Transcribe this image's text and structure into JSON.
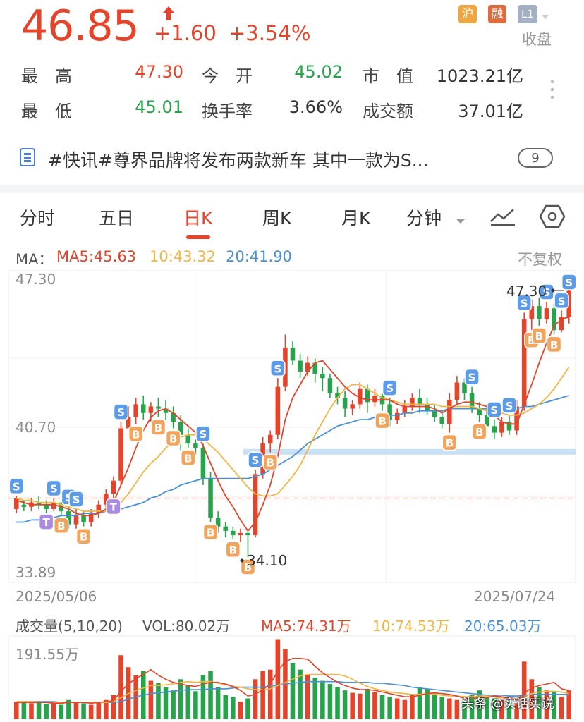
{
  "quote": {
    "price": "46.85",
    "change": "+1.60",
    "change_pct": "+3.54%",
    "badges": [
      "沪",
      "融",
      "L1"
    ],
    "market_status": "收盘",
    "stats": [
      {
        "label": "最　高",
        "value": "47.30",
        "color": "#e5432a"
      },
      {
        "label": "今　开",
        "value": "45.02",
        "color": "#27a44b"
      },
      {
        "label": "市　值",
        "value": "1023.21亿",
        "color": "#333333"
      },
      {
        "label": "最　低",
        "value": "45.01",
        "color": "#27a44b"
      },
      {
        "label": "换手率",
        "value": "3.66%",
        "color": "#333333"
      },
      {
        "label": "成交额",
        "value": "37.01亿",
        "color": "#333333"
      }
    ]
  },
  "news": {
    "text": "#快讯#尊界品牌将发布两款新车 其中一款为S...",
    "count": "9"
  },
  "tabs": [
    {
      "label": "分时",
      "active": false
    },
    {
      "label": "五日",
      "active": false
    },
    {
      "label": "日K",
      "active": true
    },
    {
      "label": "周K",
      "active": false
    },
    {
      "label": "月K",
      "active": false
    },
    {
      "label": "分钟",
      "active": false
    }
  ],
  "ma_legend": {
    "title": "MA：",
    "ma5": "MA5:45.63",
    "ma10": "10:43.32",
    "ma20": "20:41.90",
    "adjust": "不复权"
  },
  "colors": {
    "up": "#e5432a",
    "down": "#27a44b",
    "ma5": "#e5432a",
    "ma10": "#f0b542",
    "ma20": "#4a90d8",
    "buy": "#f2a35c",
    "sell": "#5b9be8",
    "t": "#a98be0"
  },
  "chart_data": {
    "type": "candlestick",
    "price_labels": [
      "47.30",
      "40.70",
      "33.89"
    ],
    "ylim": [
      33.89,
      47.3
    ],
    "date_start": "2025/05/06",
    "date_end": "2025/07/24",
    "high_label": "47.30",
    "low_label": "34.10",
    "candles": [
      [
        36.8,
        37.3,
        37.4,
        36.6
      ],
      [
        37.0,
        36.9,
        37.2,
        36.7
      ],
      [
        36.9,
        37.1,
        37.3,
        36.7
      ],
      [
        37.1,
        37.0,
        37.4,
        36.8
      ],
      [
        37.0,
        36.8,
        37.2,
        36.6
      ],
      [
        36.8,
        37.1,
        37.3,
        36.7
      ],
      [
        37.1,
        36.7,
        37.3,
        36.5
      ],
      [
        36.7,
        36.1,
        36.9,
        35.9
      ],
      [
        36.1,
        36.5,
        36.8,
        35.9
      ],
      [
        36.5,
        36.2,
        36.7,
        36.0
      ],
      [
        36.2,
        36.6,
        36.8,
        36.0
      ],
      [
        36.6,
        37.0,
        37.2,
        36.4
      ],
      [
        37.0,
        37.5,
        37.7,
        36.8
      ],
      [
        37.5,
        38.1,
        38.3,
        37.3
      ],
      [
        38.1,
        40.5,
        40.8,
        37.9
      ],
      [
        40.5,
        41.0,
        41.5,
        40.2
      ],
      [
        41.0,
        41.6,
        41.9,
        40.7
      ],
      [
        41.6,
        41.2,
        42.0,
        40.9
      ],
      [
        41.2,
        41.5,
        41.7,
        40.8
      ],
      [
        41.5,
        41.4,
        41.9,
        41.0
      ],
      [
        41.4,
        41.2,
        41.8,
        40.9
      ],
      [
        41.2,
        40.8,
        41.5,
        40.5
      ],
      [
        40.8,
        40.2,
        41.1,
        39.5
      ],
      [
        40.2,
        39.8,
        40.5,
        39.6
      ],
      [
        39.8,
        39.6,
        40.0,
        39.3
      ],
      [
        39.6,
        38.2,
        39.8,
        37.9
      ],
      [
        38.2,
        36.4,
        38.5,
        36.2
      ],
      [
        36.4,
        36.0,
        36.7,
        35.7
      ],
      [
        36.0,
        35.8,
        36.2,
        35.5
      ],
      [
        35.8,
        35.6,
        36.0,
        35.4
      ],
      [
        35.6,
        35.7,
        35.9,
        35.3
      ],
      [
        35.7,
        35.6,
        35.9,
        34.6
      ],
      [
        35.6,
        38.4,
        38.6,
        35.5
      ],
      [
        38.4,
        39.8,
        40.1,
        38.2
      ],
      [
        39.8,
        40.2,
        40.4,
        39.4
      ],
      [
        40.2,
        42.4,
        42.8,
        40.0
      ],
      [
        42.4,
        44.2,
        44.8,
        42.2
      ],
      [
        44.2,
        43.6,
        44.5,
        43.4
      ],
      [
        43.6,
        43.1,
        43.9,
        42.8
      ],
      [
        43.1,
        43.5,
        43.8,
        42.9
      ],
      [
        43.5,
        43.0,
        43.7,
        42.6
      ],
      [
        43.0,
        42.8,
        43.3,
        42.2
      ],
      [
        42.8,
        42.1,
        43.0,
        41.9
      ],
      [
        42.1,
        41.9,
        42.4,
        41.6
      ],
      [
        41.9,
        41.4,
        42.2,
        41.0
      ],
      [
        41.4,
        41.6,
        41.8,
        41.1
      ],
      [
        41.6,
        42.3,
        42.6,
        41.4
      ],
      [
        42.3,
        41.7,
        42.5,
        41.2
      ],
      [
        41.7,
        42.0,
        42.3,
        41.5
      ],
      [
        42.0,
        41.6,
        42.2,
        41.3
      ],
      [
        41.6,
        40.9,
        41.9,
        40.6
      ],
      [
        40.9,
        41.2,
        41.4,
        40.7
      ],
      [
        41.2,
        41.5,
        41.8,
        41.0
      ],
      [
        41.5,
        41.9,
        42.1,
        41.3
      ],
      [
        41.9,
        41.6,
        42.3,
        41.2
      ],
      [
        41.6,
        41.3,
        41.9,
        41.1
      ],
      [
        41.3,
        41.0,
        41.6,
        40.8
      ],
      [
        41.0,
        40.7,
        41.3,
        40.5
      ],
      [
        40.7,
        41.8,
        42.1,
        40.3
      ],
      [
        41.8,
        42.6,
        42.9,
        41.6
      ],
      [
        42.6,
        42.1,
        42.8,
        41.8
      ],
      [
        42.1,
        41.4,
        42.4,
        41.2
      ],
      [
        41.4,
        41.1,
        41.7,
        40.8
      ],
      [
        41.1,
        40.6,
        41.4,
        40.3
      ],
      [
        40.6,
        40.3,
        40.9,
        40.0
      ],
      [
        40.3,
        40.8,
        41.0,
        40.1
      ],
      [
        40.8,
        40.4,
        41.1,
        40.2
      ],
      [
        40.4,
        41.5,
        41.8,
        40.2
      ],
      [
        41.5,
        45.5,
        45.8,
        41.3
      ],
      [
        45.5,
        46.1,
        46.4,
        45.0
      ],
      [
        46.1,
        45.5,
        46.5,
        45.2
      ],
      [
        45.5,
        46.0,
        46.3,
        45.3
      ],
      [
        46.0,
        45.0,
        46.2,
        44.8
      ],
      [
        45.0,
        45.6,
        45.9,
        44.9
      ],
      [
        45.6,
        46.8,
        47.3,
        45.3
      ]
    ],
    "ma5": [
      37.2,
      37.1,
      37.0,
      37.0,
      37.0,
      37.0,
      36.9,
      36.8,
      36.6,
      36.5,
      36.5,
      36.6,
      36.8,
      37.1,
      37.9,
      38.7,
      39.6,
      40.4,
      41.0,
      41.3,
      41.4,
      41.2,
      40.9,
      40.6,
      40.3,
      39.7,
      38.9,
      38.1,
      37.4,
      36.9,
      36.3,
      35.8,
      36.2,
      37.0,
      37.9,
      39.2,
      40.9,
      41.9,
      42.5,
      43.1,
      43.5,
      43.6,
      43.2,
      42.8,
      42.4,
      42.1,
      41.9,
      41.8,
      41.8,
      41.8,
      41.8,
      41.6,
      41.5,
      41.5,
      41.5,
      41.5,
      41.4,
      41.2,
      41.4,
      41.6,
      41.7,
      41.7,
      41.6,
      41.5,
      41.1,
      40.8,
      40.7,
      40.7,
      41.6,
      42.5,
      43.5,
      44.4,
      45.2,
      45.5,
      45.6
    ],
    "ma10": [
      37.3,
      37.2,
      37.2,
      37.1,
      37.1,
      37.1,
      37.0,
      36.9,
      36.8,
      36.7,
      36.7,
      36.7,
      36.7,
      36.8,
      37.1,
      37.5,
      38.0,
      38.5,
      38.9,
      39.2,
      39.6,
      39.9,
      40.1,
      40.2,
      40.2,
      40.0,
      39.7,
      39.4,
      39.0,
      38.6,
      38.2,
      37.8,
      37.5,
      37.4,
      37.4,
      37.5,
      37.9,
      38.3,
      38.8,
      39.5,
      40.2,
      40.8,
      41.4,
      41.9,
      42.3,
      42.5,
      42.5,
      42.3,
      42.1,
      41.9,
      41.8,
      41.7,
      41.6,
      41.6,
      41.6,
      41.6,
      41.6,
      41.5,
      41.5,
      41.5,
      41.5,
      41.5,
      41.4,
      41.3,
      41.2,
      41.2,
      41.1,
      41.1,
      41.2,
      41.4,
      41.6,
      41.9,
      42.3,
      42.8,
      43.3
    ],
    "ma20": [
      36.2,
      36.2,
      36.3,
      36.3,
      36.4,
      36.4,
      36.5,
      36.5,
      36.5,
      36.6,
      36.6,
      36.6,
      36.7,
      36.7,
      36.8,
      36.9,
      37.0,
      37.1,
      37.3,
      37.4,
      37.6,
      37.7,
      37.9,
      38.0,
      38.1,
      38.2,
      38.2,
      38.2,
      38.2,
      38.2,
      38.2,
      38.2,
      38.3,
      38.4,
      38.6,
      38.8,
      39.0,
      39.2,
      39.5,
      39.8,
      40.0,
      40.2,
      40.4,
      40.6,
      40.7,
      40.8,
      40.9,
      40.9,
      41.0,
      41.0,
      41.1,
      41.1,
      41.2,
      41.2,
      41.3,
      41.3,
      41.3,
      41.3,
      41.4,
      41.4,
      41.4,
      41.4,
      41.4,
      41.4,
      41.4,
      41.4,
      41.4,
      41.4,
      41.5,
      41.5,
      41.6,
      41.7,
      41.8,
      41.9,
      42.0
    ],
    "markers": [
      {
        "i": 0,
        "t": "S"
      },
      {
        "i": 5,
        "t": "S"
      },
      {
        "i": 6,
        "t": "B"
      },
      {
        "i": 7,
        "t": "S"
      },
      {
        "i": 8,
        "t": "S"
      },
      {
        "i": 9,
        "t": "B"
      },
      {
        "i": 4,
        "t": "T"
      },
      {
        "i": 13,
        "t": "T"
      },
      {
        "i": 14,
        "t": "S"
      },
      {
        "i": 16,
        "t": "B"
      },
      {
        "i": 19,
        "t": "B"
      },
      {
        "i": 21,
        "t": "B"
      },
      {
        "i": 23,
        "t": "B"
      },
      {
        "i": 25,
        "t": "S"
      },
      {
        "i": 26,
        "t": "B"
      },
      {
        "i": 29,
        "t": "B"
      },
      {
        "i": 31,
        "t": "B"
      },
      {
        "i": 32,
        "t": "S"
      },
      {
        "i": 34,
        "t": "B"
      },
      {
        "i": 35,
        "t": "S"
      },
      {
        "i": 49,
        "t": "B"
      },
      {
        "i": 50,
        "t": "S"
      },
      {
        "i": 58,
        "t": "B"
      },
      {
        "i": 61,
        "t": "S"
      },
      {
        "i": 62,
        "t": "B"
      },
      {
        "i": 64,
        "t": "S"
      },
      {
        "i": 66,
        "t": "S"
      },
      {
        "i": 68,
        "t": "S"
      },
      {
        "i": 69,
        "t": "B"
      },
      {
        "i": 70,
        "t": "B"
      },
      {
        "i": 71,
        "t": "S"
      },
      {
        "i": 72,
        "t": "B"
      },
      {
        "i": 73,
        "t": "S"
      },
      {
        "i": 74,
        "t": "S"
      }
    ],
    "volume": [
      22,
      21,
      20,
      22,
      19,
      20,
      18,
      24,
      22,
      20,
      18,
      21,
      24,
      30,
      80,
      65,
      55,
      60,
      48,
      45,
      40,
      36,
      50,
      42,
      35,
      55,
      60,
      40,
      30,
      28,
      22,
      26,
      50,
      60,
      62,
      100,
      88,
      70,
      62,
      56,
      52,
      48,
      44,
      40,
      36,
      33,
      32,
      38,
      34,
      30,
      28,
      26,
      24,
      30,
      40,
      38,
      32,
      28,
      26,
      24,
      22,
      30,
      36,
      28,
      26,
      24,
      22,
      20,
      72,
      50,
      40,
      36,
      34,
      28,
      36
    ],
    "vol_ma5": [
      21,
      21,
      21,
      21,
      21,
      20,
      20,
      21,
      21,
      21,
      20,
      21,
      22,
      23,
      35,
      44,
      51,
      56,
      62,
      55,
      50,
      46,
      44,
      42,
      41,
      44,
      46,
      46,
      44,
      41,
      36,
      29,
      31,
      37,
      44,
      60,
      72,
      76,
      76,
      75,
      66,
      58,
      52,
      46,
      42,
      39,
      37,
      37,
      36,
      34,
      32,
      30,
      28,
      28,
      30,
      32,
      33,
      32,
      31,
      29,
      26,
      26,
      27,
      27,
      29,
      28,
      27,
      24,
      33,
      39,
      42,
      44,
      46,
      38,
      36
    ],
    "vol_ma10": [
      22,
      22,
      22,
      21,
      21,
      21,
      21,
      21,
      21,
      21,
      21,
      21,
      21,
      22,
      27,
      32,
      36,
      39,
      42,
      42,
      43,
      44,
      46,
      47,
      46,
      47,
      47,
      45,
      43,
      41,
      40,
      38,
      37,
      37,
      38,
      42,
      46,
      50,
      54,
      56,
      56,
      56,
      56,
      56,
      54,
      50,
      45,
      41,
      38,
      36,
      34,
      33,
      32,
      31,
      31,
      32,
      31,
      30,
      29,
      29,
      28,
      28,
      29,
      29,
      28,
      27,
      26,
      25,
      28,
      32,
      34,
      35,
      35,
      34,
      32
    ],
    "vol_ma20": [
      22,
      22,
      22,
      22,
      22,
      22,
      21,
      21,
      21,
      21,
      21,
      21,
      21,
      21,
      22,
      25,
      28,
      30,
      32,
      33,
      34,
      35,
      36,
      37,
      37,
      37,
      38,
      38,
      38,
      39,
      40,
      40,
      40,
      40,
      41,
      43,
      44,
      45,
      46,
      47,
      47,
      47,
      47,
      47,
      46,
      46,
      46,
      46,
      45,
      45,
      44,
      43,
      42,
      40,
      39,
      38,
      37,
      36,
      35,
      34,
      33,
      32,
      31,
      30,
      30,
      30,
      29,
      29,
      30,
      31,
      31,
      31,
      31,
      31,
      31
    ],
    "vol_labels": {
      "title": "成交量(5,10,20)",
      "vol": "VOL:80.02万",
      "ma5": "MA5:74.31万",
      "ma10": "10:74.53万",
      "ma20": "20:65.03万",
      "max": "191.55万"
    }
  },
  "watermark": "头条 @实话实说"
}
